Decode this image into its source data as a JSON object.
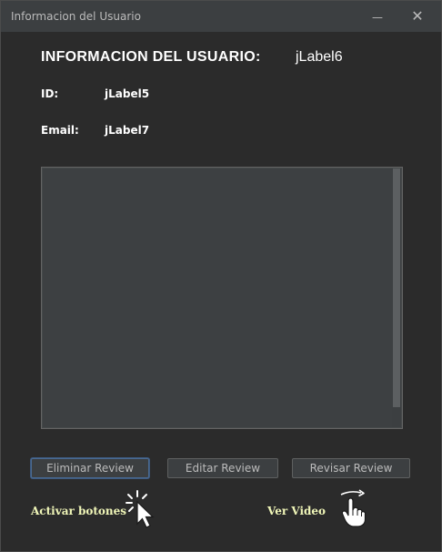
{
  "window": {
    "title": "Informacion del Usuario",
    "minimize_glyph": "—",
    "close_glyph": "✕"
  },
  "header": {
    "title": "INFORMACION DEL USUARIO:",
    "username_value": "jLabel6"
  },
  "fields": {
    "id_label": "ID:",
    "id_value": "jLabel5",
    "email_label": "Email:",
    "email_value": "jLabel7"
  },
  "review_area": {
    "text": ""
  },
  "buttons": {
    "delete_label": "Eliminar Review",
    "edit_label": "Editar Review",
    "review_label": "Revisar Review"
  },
  "actions": {
    "activate_label": "Activar botones",
    "activate_icon": "cursor-click-icon",
    "video_label": "Ver Video",
    "video_icon": "hand-swipe-icon"
  },
  "colors": {
    "background": "#2b2b2b",
    "titlebar": "#3c3f41",
    "link_text": "#f0f6b8",
    "focus_border": "#4a6a92"
  }
}
